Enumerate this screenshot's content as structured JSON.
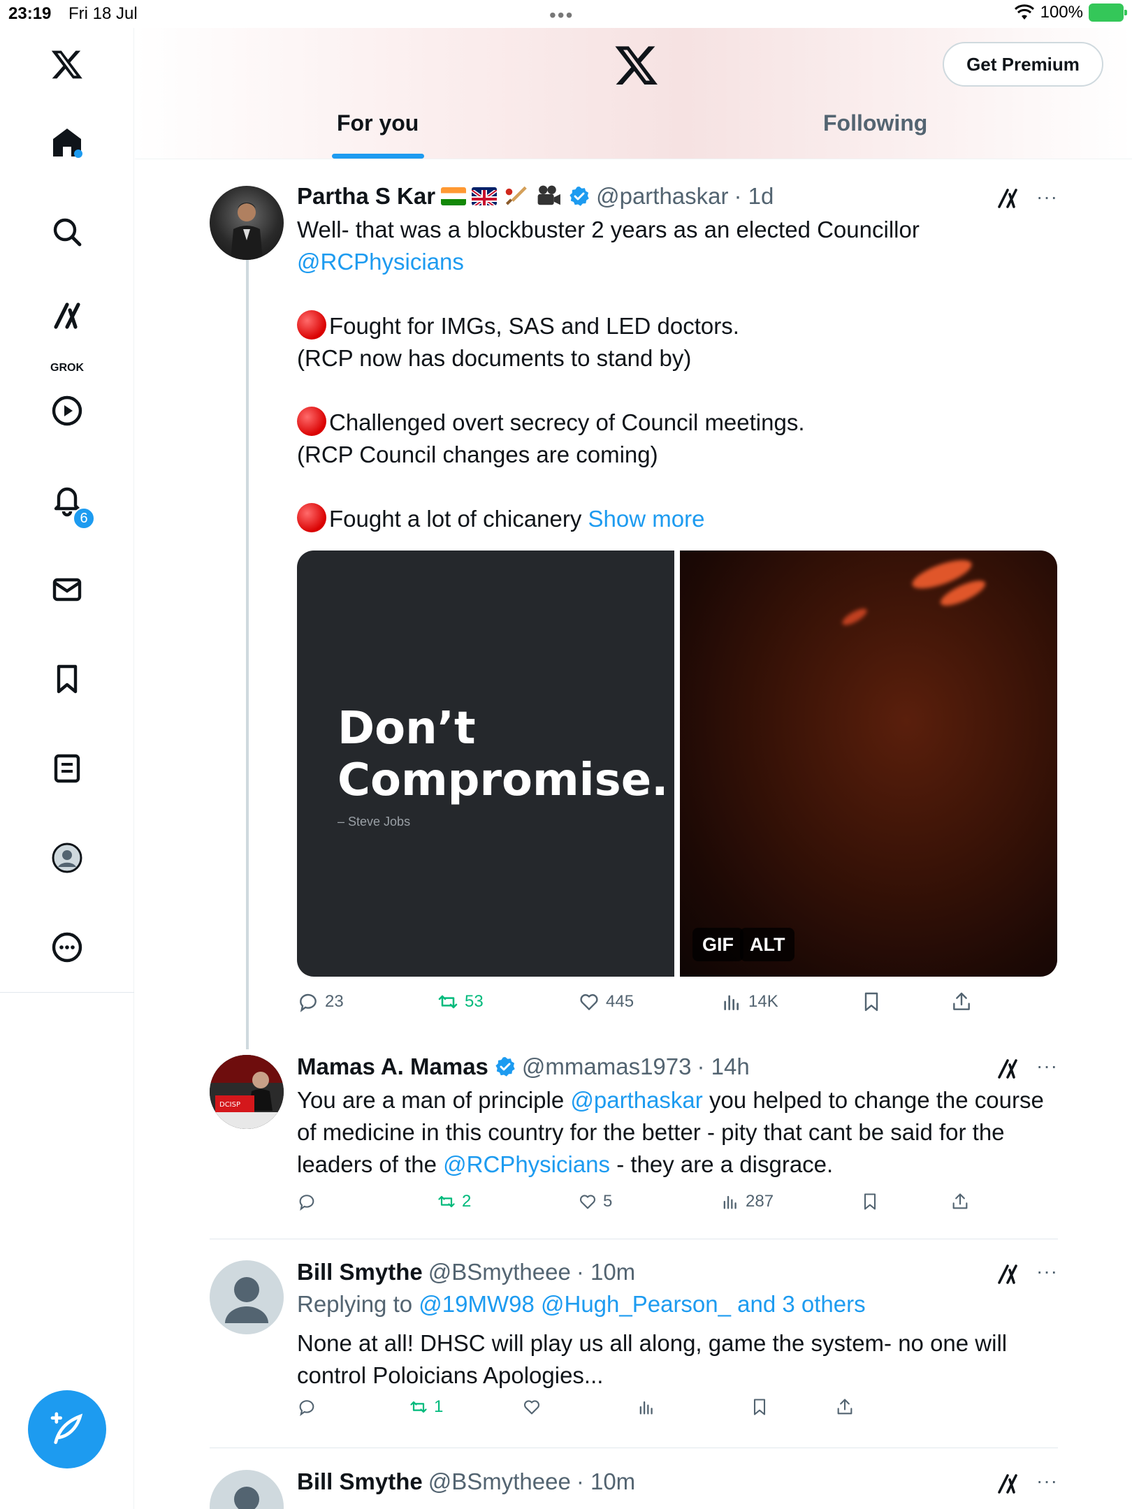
{
  "status_bar": {
    "time": "23:19",
    "date": "Fri 18 Jul",
    "battery": "100%"
  },
  "sidebar": {
    "grok_label": "GROK",
    "notification_count": "6"
  },
  "header": {
    "premium_label": "Get Premium",
    "tabs": [
      {
        "label": "For you",
        "active": true
      },
      {
        "label": "Following",
        "active": false
      }
    ]
  },
  "tweets": [
    {
      "name": "Partha S Kar",
      "handle": "@parthaskar",
      "time": "· 1d",
      "text_line1": "Well- that was a blockbuster 2 years as an elected Councillor",
      "mention": "@RCPhysicians",
      "para1_a": "Fought for IMGs, SAS and LED doctors.",
      "para1_b": "(RCP now has documents to stand by)",
      "para2_a": "Challenged overt secrecy of Council meetings.",
      "para2_b": "(RCP Council changes are coming)",
      "para3": "Fought a lot of chicanery",
      "show_more": "Show more",
      "media": {
        "quote_line1": "Don’t",
        "quote_line2": "Compromise.",
        "attribution": "– Steve Jobs",
        "gif_badge": "GIF",
        "alt_badge": "ALT"
      },
      "stats": {
        "replies": "23",
        "retweets": "53",
        "likes": "445",
        "views": "14K"
      }
    },
    {
      "name": "Mamas A. Mamas",
      "handle": "@mmamas1973",
      "time": "· 14h",
      "text_a": "You are a man of principle ",
      "mention1": "@parthaskar",
      "text_b": " you helped to change the course of medicine in this country for the better - pity that cant be said for the leaders of the ",
      "mention2": "@RCPhysicians",
      "text_c": " - they are a disgrace.",
      "stats": {
        "replies": "",
        "retweets": "2",
        "likes": "5",
        "views": "287"
      }
    },
    {
      "name": "Bill Smythe",
      "handle": "@BSmytheee",
      "time": "· 10m",
      "replying_prefix": "Replying to ",
      "replying_to": "@19MW98 @Hugh_Pearson_ and 3 others",
      "text": "None at all! DHSC will play us all along, game the system- no one will control Poloicians Apologies...",
      "stats": {
        "replies": "",
        "retweets": "1",
        "likes": "",
        "views": ""
      }
    },
    {
      "name": "Bill Smythe",
      "handle": "@BSmytheee",
      "time": "· 10m"
    }
  ],
  "colors": {
    "accent": "#1d9bf0",
    "retweet": "#00ba7c",
    "text": "#0f1419",
    "muted": "#536471"
  }
}
